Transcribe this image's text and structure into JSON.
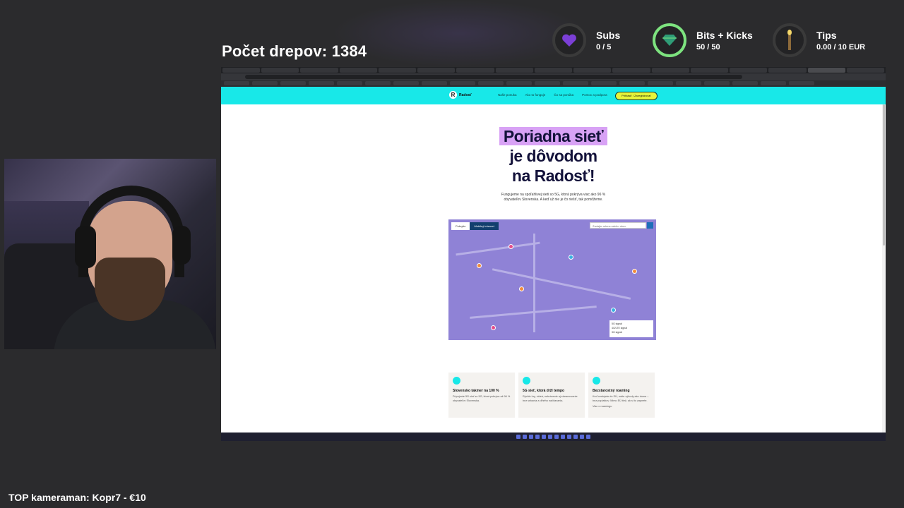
{
  "overlay": {
    "counter_text": "Počet drepov: 1384",
    "top_cameraman": "TOP kameraman: Kopr7 - €10",
    "goals": [
      {
        "title": "Subs",
        "value": "0 / 5",
        "icon": "heart-icon",
        "color": "#7b3fd6"
      },
      {
        "title": "Bits + Kicks",
        "value": "50 / 50",
        "icon": "gem-icon",
        "color": "#7de37f"
      },
      {
        "title": "Tips",
        "value": "0.00 / 10 EUR",
        "icon": "candle-icon",
        "color": "#c8a24a"
      }
    ]
  },
  "browser": {
    "site": {
      "brand": "Radosť",
      "nav": [
        "Naše ponuka",
        "Ako to funguje",
        "Čo sa ponúka",
        "Pomoc a podpora"
      ],
      "cta": "Prihlásiť / Zaregistrovať",
      "headline_line1": "Poriadna sieť",
      "headline_line2": "je dôvodom",
      "headline_line3": "na Radosť!",
      "sub": "Fungujeme na spoľahlivej sieti so 5G, ktorá pokrýva viac ako 96 % obyvateľov Slovenska. A keď už nie je čo riešiť, tak pomôžeme.",
      "map": {
        "tabs": [
          "Pokrytie",
          "Mobilný internet"
        ],
        "search_placeholder": "Zadajte adresu alebo obec",
        "legend": [
          "5G signál",
          "4G/LTE signál",
          "3G signál"
        ]
      },
      "cards": [
        {
          "title": "Slovensko takmer na 100 %",
          "desc": "Pripojenie 5G sieť so 5G, ktorá pokrýva až 96 % obyvateľov Slovenska."
        },
        {
          "title": "5G sieť, ktorá drží tempo",
          "desc": "Rýchle hry, videá, nahrávanie aj streamovanie bez sekania a dlhého načítavania."
        },
        {
          "title": "Bezstarostný roaming",
          "desc": "Keď cestujete do EÚ, máte výhody ako doma – bez poplatkov. Mimo EÚ tiež, ak si to zapnete.",
          "link": "Viac o roamingu"
        }
      ]
    }
  }
}
